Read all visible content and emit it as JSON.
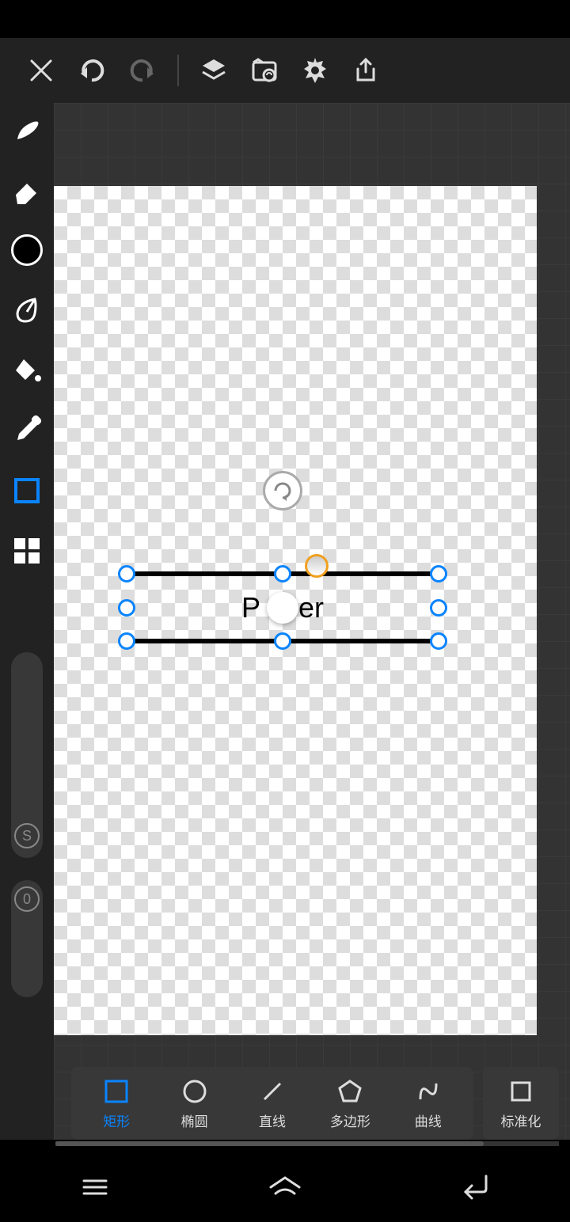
{
  "toolbar": {
    "close": "close",
    "undo": "undo",
    "redo": "redo",
    "layers": "layers",
    "image": "image",
    "settings": "settings",
    "share": "share"
  },
  "side": {
    "tools": [
      "brush",
      "eraser",
      "color",
      "leaf",
      "bucket",
      "eyedropper",
      "rect",
      "grid"
    ],
    "s_label": "S",
    "o_label": "0"
  },
  "canvas": {
    "text_left": "P",
    "text_right": "er"
  },
  "bottom": {
    "options": [
      {
        "label": "矩形",
        "icon": "rect",
        "active": true
      },
      {
        "label": "椭圆",
        "icon": "circle",
        "active": false
      },
      {
        "label": "直线",
        "icon": "line",
        "active": false
      },
      {
        "label": "多边形",
        "icon": "polygon",
        "active": false
      },
      {
        "label": "曲线",
        "icon": "curve",
        "active": false
      }
    ],
    "normalize": "标准化"
  },
  "colors": {
    "accent": "#0a84ff",
    "bg": "#222",
    "panel": "#383838"
  }
}
